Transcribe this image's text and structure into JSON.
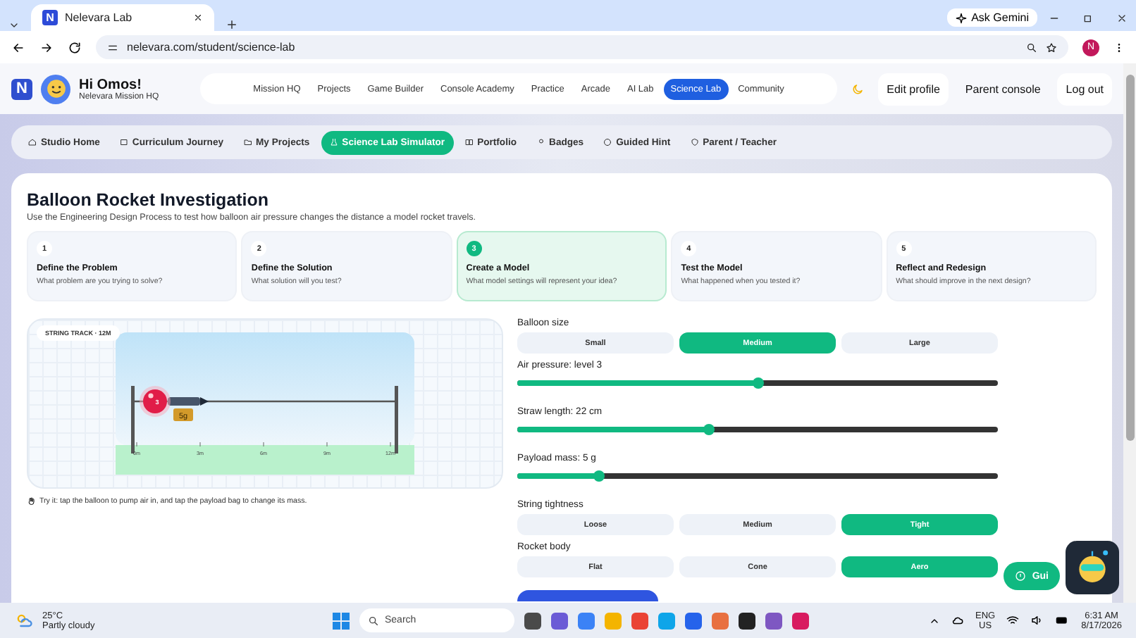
{
  "browser": {
    "favicon": "N",
    "tab_title": "Nelevara Lab",
    "url": "nelevara.com/student/science-lab",
    "ask_gemini": "Ask Gemini",
    "profile_initial": "N"
  },
  "header": {
    "logo": "N",
    "greeting": "Hi Omos!",
    "subtitle": "Nelevara Mission HQ",
    "nav": [
      {
        "label": "Mission HQ",
        "selected": false
      },
      {
        "label": "Projects",
        "selected": false
      },
      {
        "label": "Game Builder",
        "selected": false
      },
      {
        "label": "Console Academy",
        "selected": false
      },
      {
        "label": "Practice",
        "selected": false
      },
      {
        "label": "Arcade",
        "selected": false
      },
      {
        "label": "AI Lab",
        "selected": false
      },
      {
        "label": "Science Lab",
        "selected": true
      },
      {
        "label": "Community",
        "selected": false
      }
    ],
    "buttons": [
      "Edit profile",
      "Parent console",
      "Log out"
    ]
  },
  "subnav": [
    {
      "label": "Studio Home",
      "selected": false
    },
    {
      "label": "Curriculum Journey",
      "selected": false
    },
    {
      "label": "My Projects",
      "selected": false
    },
    {
      "label": "Science Lab Simulator",
      "selected": true
    },
    {
      "label": "Portfolio",
      "selected": false
    },
    {
      "label": "Badges",
      "selected": false
    },
    {
      "label": "Guided Hint",
      "selected": false
    },
    {
      "label": "Parent / Teacher",
      "selected": false
    }
  ],
  "card": {
    "title": "Balloon Rocket Investigation",
    "description": "Use the Engineering Design Process to test how balloon air pressure changes the distance a model rocket travels.",
    "steps": [
      {
        "number": "1",
        "title": "Define the Problem",
        "prompt": "What problem are you trying to solve?",
        "selected": false
      },
      {
        "number": "2",
        "title": "Define the Solution",
        "prompt": "What solution will you test?",
        "selected": false
      },
      {
        "number": "3",
        "title": "Create a Model",
        "prompt": "What model settings will represent your idea?",
        "selected": true
      },
      {
        "number": "4",
        "title": "Test the Model",
        "prompt": "What happened when you tested it?",
        "selected": false
      },
      {
        "number": "5",
        "title": "Reflect and Redesign",
        "prompt": "What should improve in the next design?",
        "selected": false
      }
    ]
  },
  "simulation": {
    "track_label": "STRING TRACK · 12M",
    "balloon_label": "3",
    "payload_label": "5g",
    "ticks": [
      "0m",
      "3m",
      "6m",
      "9m",
      "12m"
    ],
    "hint": "Try it: tap the balloon to pump air in, and tap the payload bag to change its mass."
  },
  "controls": [
    {
      "kind": "choice",
      "label": "Balloon size",
      "options": [
        {
          "label": "Small",
          "selected": false
        },
        {
          "label": "Medium",
          "selected": true
        },
        {
          "label": "Large",
          "selected": false
        }
      ]
    },
    {
      "kind": "slider",
      "label": "Air pressure: level 3",
      "level": 0.5
    },
    {
      "kind": "slider",
      "label": "Straw length: 22 cm",
      "level": 0.4
    },
    {
      "kind": "slider",
      "label": "Payload mass: 5 g",
      "level": 0.17
    },
    {
      "kind": "choice",
      "label": "String tightness",
      "options": [
        {
          "label": "Loose",
          "selected": false
        },
        {
          "label": "Medium",
          "selected": false
        },
        {
          "label": "Tight",
          "selected": true
        }
      ]
    },
    {
      "kind": "choice",
      "label": "Rocket body",
      "options": [
        {
          "label": "Flat",
          "selected": false
        },
        {
          "label": "Cone",
          "selected": false
        },
        {
          "label": "Aero",
          "selected": true
        }
      ]
    }
  ],
  "guide_button": "Gui",
  "taskbar": {
    "temperature": "25°C",
    "weather": "Partly cloudy",
    "search_placeholder": "Search",
    "language": "ENG",
    "region": "US",
    "time": "6:31 AM",
    "date": "8/17/2026"
  }
}
